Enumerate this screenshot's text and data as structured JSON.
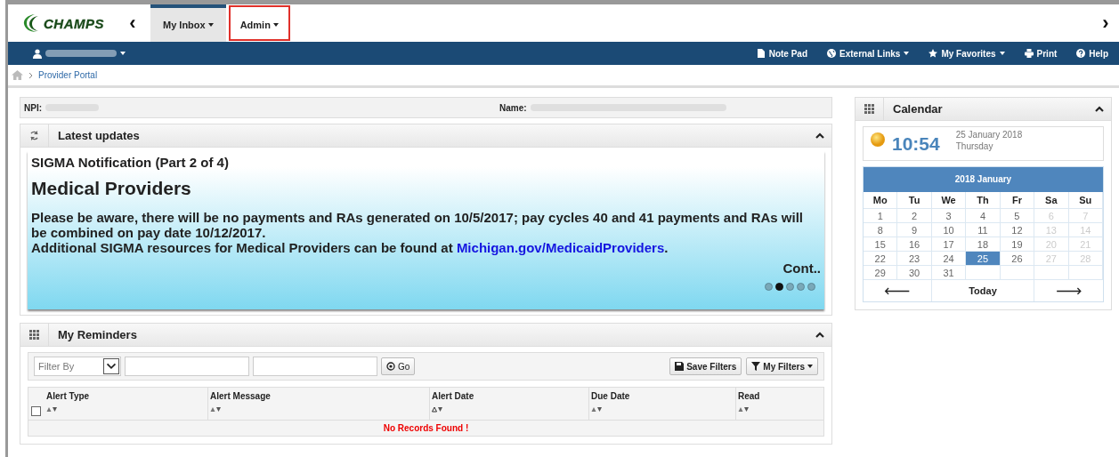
{
  "top_nav": {
    "logo": "CHAMPS",
    "back": "‹",
    "forward": "›",
    "tabs": [
      {
        "label": "My Inbox",
        "selected": true,
        "highlighted": false
      },
      {
        "label": "Admin",
        "selected": false,
        "highlighted": true
      }
    ]
  },
  "toolbar": {
    "user": {
      "redacted": true
    },
    "links": [
      {
        "kind": "notepad",
        "label": "Note Pad",
        "dropdown": false
      },
      {
        "kind": "globe",
        "label": "External Links",
        "dropdown": true
      },
      {
        "kind": "star",
        "label": "My Favorites",
        "dropdown": true
      },
      {
        "kind": "print",
        "label": "Print",
        "dropdown": false
      },
      {
        "kind": "help",
        "label": "Help",
        "dropdown": false
      }
    ]
  },
  "breadcrumb": [
    "Provider Portal"
  ],
  "info_bar": [
    {
      "label": "NPI:",
      "redacted": true
    },
    {
      "label": "Name:",
      "redacted": true
    }
  ],
  "latest_updates": {
    "title": "Latest updates",
    "notice_title": "SIGMA Notification (Part 2 of 4)",
    "heading": "Medical Providers",
    "body": "Please be aware, there will be no payments and RAs generated on 10/5/2017; pay cycles 40 and 41 payments and RAs will be combined on pay date 10/12/2017.",
    "more_prefix": "Additional SIGMA resources for Medical Providers can be found at ",
    "more_link": "Michigan.gov/MedicaidProviders",
    "more_suffix": ".",
    "cont": "Cont..",
    "dots": [
      {
        "selected": false
      },
      {
        "selected": true
      },
      {
        "selected": false
      },
      {
        "selected": false
      },
      {
        "selected": false
      }
    ]
  },
  "reminders": {
    "title": "My Reminders",
    "filter": {
      "placeholder": "Filter By"
    },
    "go": "Go",
    "save_filters": "Save Filters",
    "my_filters": "My Filters",
    "columns": [
      {
        "label": "Alert Type",
        "sorted": false
      },
      {
        "label": "Alert Message",
        "sorted": false
      },
      {
        "label": "Alert Date",
        "sorted": true
      },
      {
        "label": "Due Date",
        "sorted": false
      },
      {
        "label": "Read",
        "sorted": false
      }
    ],
    "select_all": {
      "checked": false
    },
    "empty": "No Records Found !"
  },
  "calendar": {
    "title": "Calendar",
    "time": "10:54",
    "date": "25 January 2018",
    "weekday": "Thursday",
    "month": "2018 January",
    "day_names": [
      "Mo",
      "Tu",
      "We",
      "Th",
      "Fr",
      "Sa",
      "Su"
    ],
    "weeks": [
      [
        {
          "day": "1",
          "selected": false,
          "disabled": false
        },
        {
          "day": "2",
          "selected": false,
          "disabled": false
        },
        {
          "day": "3",
          "selected": false,
          "disabled": false
        },
        {
          "day": "4",
          "selected": false,
          "disabled": false
        },
        {
          "day": "5",
          "selected": false,
          "disabled": false
        },
        {
          "day": "6",
          "selected": false,
          "disabled": true
        },
        {
          "day": "7",
          "selected": false,
          "disabled": true
        }
      ],
      [
        {
          "day": "8",
          "selected": false,
          "disabled": false
        },
        {
          "day": "9",
          "selected": false,
          "disabled": false
        },
        {
          "day": "10",
          "selected": false,
          "disabled": false
        },
        {
          "day": "11",
          "selected": false,
          "disabled": false
        },
        {
          "day": "12",
          "selected": false,
          "disabled": false
        },
        {
          "day": "13",
          "selected": false,
          "disabled": true
        },
        {
          "day": "14",
          "selected": false,
          "disabled": true
        }
      ],
      [
        {
          "day": "15",
          "selected": false,
          "disabled": false
        },
        {
          "day": "16",
          "selected": false,
          "disabled": false
        },
        {
          "day": "17",
          "selected": false,
          "disabled": false
        },
        {
          "day": "18",
          "selected": false,
          "disabled": false
        },
        {
          "day": "19",
          "selected": false,
          "disabled": false
        },
        {
          "day": "20",
          "selected": false,
          "disabled": true
        },
        {
          "day": "21",
          "selected": false,
          "disabled": true
        }
      ],
      [
        {
          "day": "22",
          "selected": false,
          "disabled": false
        },
        {
          "day": "23",
          "selected": false,
          "disabled": false
        },
        {
          "day": "24",
          "selected": false,
          "disabled": false
        },
        {
          "day": "25",
          "selected": true,
          "disabled": false
        },
        {
          "day": "26",
          "selected": false,
          "disabled": false
        },
        {
          "day": "27",
          "selected": false,
          "disabled": true
        },
        {
          "day": "28",
          "selected": false,
          "disabled": true
        }
      ],
      [
        {
          "day": "29",
          "selected": false,
          "disabled": false
        },
        {
          "day": "30",
          "selected": false,
          "disabled": false
        },
        {
          "day": "31",
          "selected": false,
          "disabled": false
        }
      ]
    ],
    "prev": "🡐",
    "today": "Today",
    "next": "🡒"
  }
}
